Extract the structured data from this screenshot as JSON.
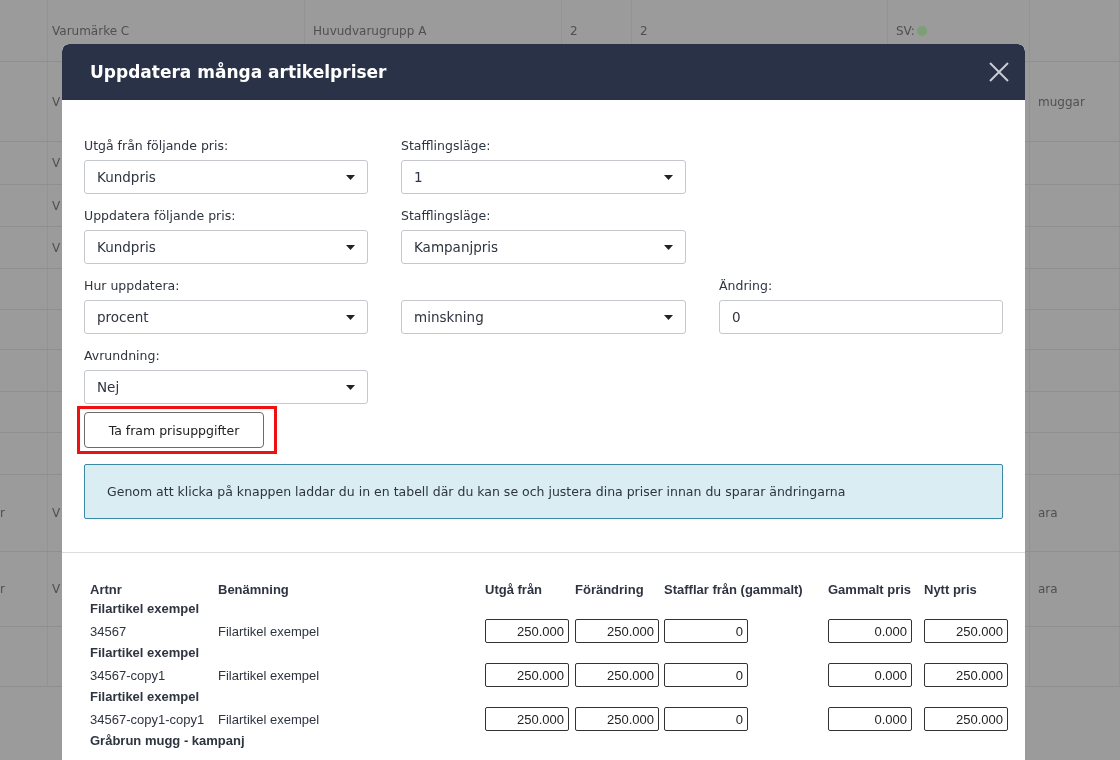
{
  "background_table": {
    "rows": [
      {
        "column_2": "Varumärke C",
        "column_3": "Huvudvarugrupp A",
        "column_4": "2",
        "column_5": "2",
        "column_6": {
          "text": "SV:",
          "color": "#7c9f74"
        }
      },
      {
        "column_2": "V",
        "column_7": "muggar"
      },
      {
        "column_2": "V"
      },
      {
        "column_2": "V"
      },
      {
        "column_2": "V"
      },
      {
        "column_1": "r",
        "column_2": "V",
        "column_7": "ara"
      },
      {
        "column_1": "r",
        "column_2": "V",
        "column_7": "ara"
      }
    ]
  },
  "dialog": {
    "title": "Uppdatera många artikelpriser",
    "close": true,
    "form_rows": [
      [
        {
          "label": "Utgå från följande pris:",
          "kind": "select",
          "value": "Kundpris"
        },
        {
          "label": "Stafflingsläge:",
          "kind": "select",
          "value": "1"
        }
      ],
      [
        {
          "label": "Uppdatera följande pris:",
          "kind": "select",
          "value": "Kundpris"
        },
        {
          "label": "Stafflingsläge:",
          "kind": "select",
          "value": "Kampanjpris"
        }
      ],
      [
        {
          "label": "Hur uppdatera:",
          "kind": "select",
          "value": "procent"
        },
        {
          "kind": "select",
          "value": "minskning"
        },
        {
          "label": "Ändring:",
          "kind": "input",
          "value": "0"
        }
      ],
      [
        {
          "label": "Avrundning:",
          "kind": "select",
          "value": "Nej"
        }
      ]
    ],
    "fetch_button": {
      "label": "Ta fram prisuppgifter",
      "highlighted": true
    },
    "info": "Genom att klicka på knappen laddar du in en tabell där du kan se och justera dina priser innan du sparar ändringarna",
    "table": {
      "columns": [
        "Artnr",
        "Benämning",
        "Utgå från",
        "Förändring",
        "Stafflar från (gammalt)",
        "Gammalt pris",
        "Nytt pris"
      ],
      "groups": [
        {
          "title": "Filartikel exempel",
          "rows": [
            {
              "artnr": "34567",
              "name": "Filartikel exempel",
              "values": [
                "250.000",
                "250.000",
                "0",
                "0.000",
                "250.000"
              ]
            }
          ]
        },
        {
          "title": "Filartikel exempel",
          "rows": [
            {
              "artnr": "34567-copy1",
              "name": "Filartikel exempel",
              "values": [
                "250.000",
                "250.000",
                "0",
                "0.000",
                "250.000"
              ]
            }
          ]
        },
        {
          "title": "Filartikel exempel",
          "rows": [
            {
              "artnr": "34567-copy1-copy1",
              "name": "Filartikel exempel",
              "values": [
                "250.000",
                "250.000",
                "0",
                "0.000",
                "250.000"
              ]
            }
          ]
        },
        {
          "title": "Gråbrun mugg - kampanj"
        }
      ]
    }
  }
}
